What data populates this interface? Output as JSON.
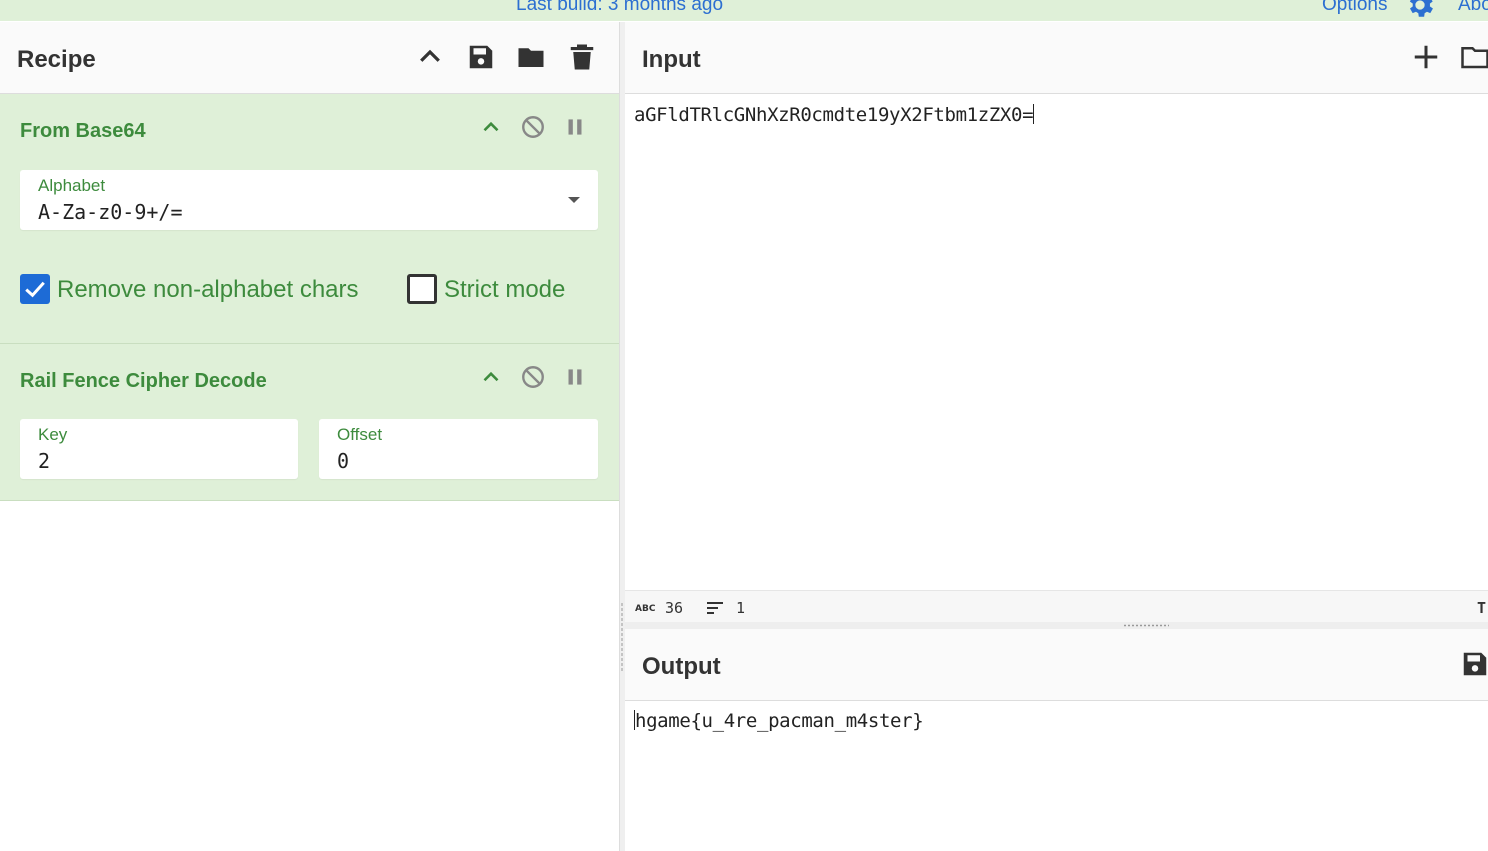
{
  "banner": {
    "build_text": "Last build: 3 months ago",
    "options_label": "Options",
    "about_label": "About",
    "link_color": "#2c6fd1",
    "background": "#dff0d8"
  },
  "recipe": {
    "title": "Recipe",
    "header_icons": [
      "chevron-up-icon",
      "save-icon",
      "folder-icon",
      "trash-icon"
    ],
    "operations": [
      {
        "name": "From Base64",
        "controls": [
          "chevron-up-icon",
          "disable-icon",
          "pause-icon"
        ],
        "alphabet_label": "Alphabet",
        "alphabet_value": "A-Za-z0-9+/=",
        "checkboxes": [
          {
            "label": "Remove non-alphabet chars",
            "checked": true
          },
          {
            "label": "Strict mode",
            "checked": false
          }
        ]
      },
      {
        "name": "Rail Fence Cipher Decode",
        "controls": [
          "chevron-up-icon",
          "disable-icon",
          "pause-icon"
        ],
        "key_label": "Key",
        "key_value": "2",
        "offset_label": "Offset",
        "offset_value": "0"
      }
    ],
    "op_background": "#dff0d8",
    "op_title_color": "#3d8b3d"
  },
  "input": {
    "title": "Input",
    "header_icons": [
      "plus-icon",
      "folder-icon"
    ],
    "text": "aGFldTRlcGNhXzR0cmdte19yX2Ftbm1zZX0=",
    "status": {
      "length": "36",
      "lines": "1",
      "trailing": "T"
    }
  },
  "output": {
    "title": "Output",
    "header_icons": [
      "save-icon"
    ],
    "text": "hgame{u_4re_pacman_m4ster}"
  }
}
